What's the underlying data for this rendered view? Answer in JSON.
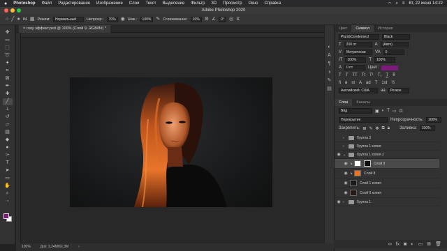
{
  "menubar": {
    "app": "Photoshop",
    "items": [
      "Файл",
      "Редактирование",
      "Изображение",
      "Слои",
      "Текст",
      "Выделение",
      "Фильтр",
      "3D",
      "Просмотр",
      "Окно",
      "Справка"
    ],
    "clock": "Вт, 22 июня 14:22"
  },
  "window": {
    "title": "Adobe Photoshop 2020"
  },
  "options": {
    "brush_size": "84",
    "mode_label": "Режим:",
    "mode_value": "Нормальный",
    "opacity_label": "Непрозр.:",
    "opacity_value": "70%",
    "flow_label": "Наж.:",
    "flow_value": "100%",
    "smoothing_label": "Сглаживание:",
    "smoothing_value": "10%",
    "angle_value": "0°"
  },
  "document": {
    "tab": "глоу эффект.psd @ 100% (Слой 9, RGB/8#) *",
    "zoom": "100%",
    "doc_info": "Док: 3,24M/62,3M"
  },
  "colors": {
    "foreground": "#7c1c7a",
    "background": "#ffffff",
    "highlight_orange": "#e8752a"
  },
  "panels": {
    "top_tabs": [
      "Цвет",
      "Символ",
      "История"
    ],
    "active_top_tab": "Символ",
    "character": {
      "font": "PlumbCondensed",
      "style": "Black",
      "size": "200 пт",
      "leading": "(Авто)",
      "tracking_label": "Метрически",
      "tracking_value": "0",
      "scale_v": "100%",
      "scale_h": "100%",
      "baseline": "0 пт",
      "color_label": "Цвет:",
      "language": "Английский: США",
      "aa": "aa",
      "antialias": "Резкое"
    },
    "layer_tabs": [
      "Слои",
      "Каналы"
    ],
    "active_layer_tab": "Слои",
    "filter_kind": "Вид",
    "blend_mode": "Перекрытие",
    "opacity_label": "Непрозрачность:",
    "opacity_value": "100%",
    "lock_label": "Закрепить:",
    "fill_label": "Заливка:",
    "fill_value": "100%",
    "layers": [
      {
        "name": "Группа 3",
        "kind": "group",
        "visible": false,
        "selected": false
      },
      {
        "name": "Группа 1 копия",
        "kind": "group",
        "visible": false,
        "selected": false
      },
      {
        "name": "Группа 1 копия 2",
        "kind": "group-open",
        "visible": true,
        "selected": false
      },
      {
        "name": "Слой 9",
        "kind": "layer",
        "visible": true,
        "selected": true
      },
      {
        "name": "Слой 8",
        "kind": "layer",
        "visible": true,
        "selected": false
      },
      {
        "name": "Слой 1 копия",
        "kind": "layer",
        "visible": true,
        "selected": false
      },
      {
        "name": "Слой 0 копия",
        "kind": "layer",
        "visible": true,
        "selected": false
      },
      {
        "name": "Группа 1",
        "kind": "group",
        "visible": true,
        "selected": false
      }
    ]
  }
}
